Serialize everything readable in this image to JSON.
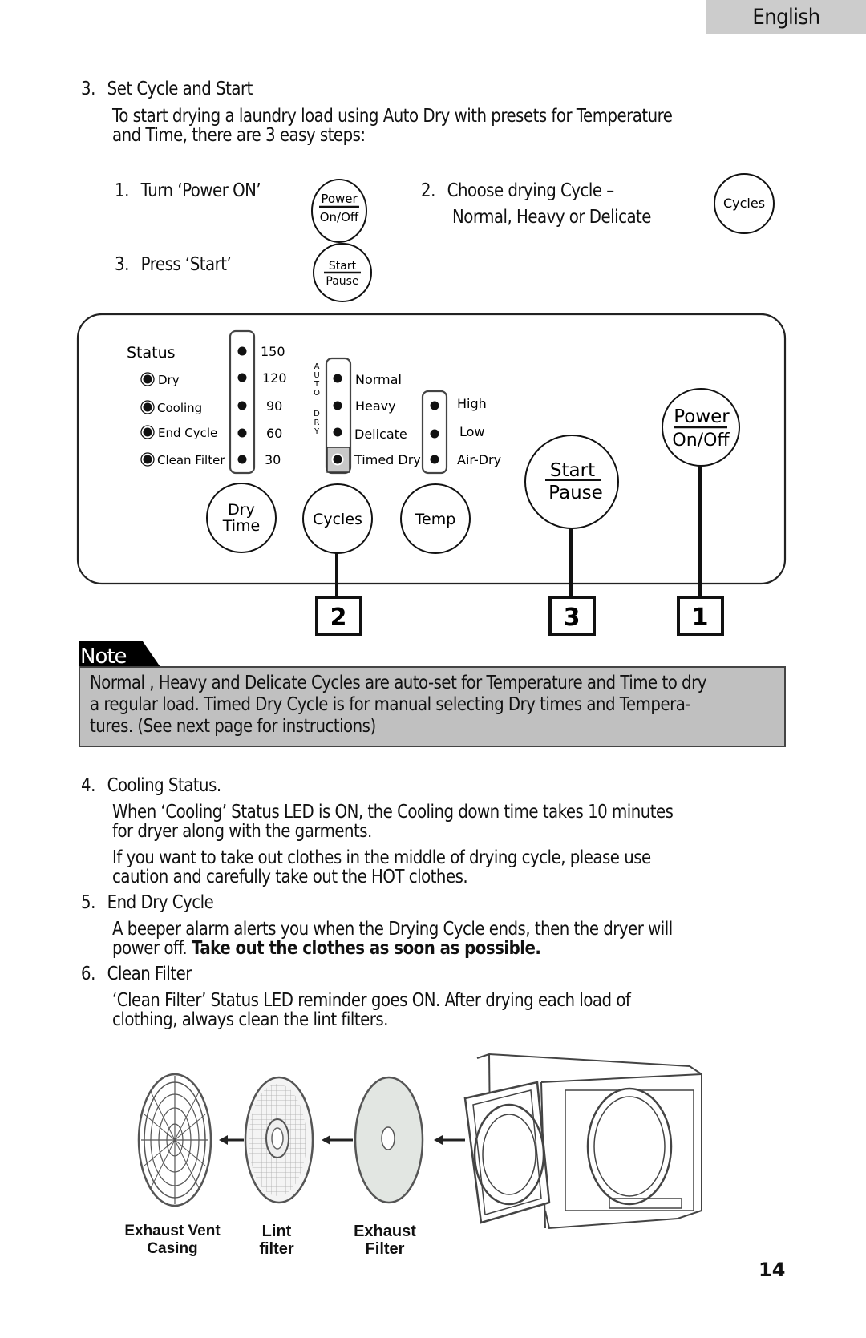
{
  "header": {
    "language_tab": "English"
  },
  "section3": {
    "heading_number": "3.",
    "heading": "Set Cycle and Start",
    "intro_lines": [
      "To start drying a laundry load using Auto Dry with presets for Temperature",
      "and Time, there are 3 easy steps:"
    ],
    "steps": [
      {
        "number": "1.",
        "text": "Turn ‘Power ON’",
        "icon_top": "Power",
        "icon_bottom": "On/Off"
      },
      {
        "number": "2.",
        "text_line1": "Choose drying Cycle –",
        "text_line2": "Normal, Heavy or Delicate",
        "icon_label": "Cycles"
      },
      {
        "number": "3.",
        "text": "Press ‘Start’",
        "icon_top": "Start",
        "icon_bottom": "Pause"
      }
    ]
  },
  "control_panel": {
    "status": {
      "title": "Status",
      "items": [
        "Dry",
        "Cooling",
        "End Cycle",
        "Clean Filter"
      ]
    },
    "dry_time": {
      "values": [
        "150",
        "120",
        "90",
        "60",
        "30"
      ],
      "button_line1": "Dry",
      "button_line2": "Time"
    },
    "cycles": {
      "vertical_label_auto": [
        "A",
        "U",
        "T",
        "O"
      ],
      "vertical_label_dry": [
        "D",
        "R",
        "Y"
      ],
      "options": [
        "Normal",
        "Heavy",
        "Delicate",
        "Timed Dry"
      ],
      "selected": "Timed Dry",
      "button_label": "Cycles"
    },
    "temp": {
      "options": [
        "High",
        "Low",
        "Air-Dry"
      ],
      "button_label": "Temp"
    },
    "start_button": {
      "top": "Start",
      "bottom": "Pause"
    },
    "power_button": {
      "top": "Power",
      "bottom": "On/Off"
    },
    "callouts": [
      {
        "label": "2",
        "target": "Cycles"
      },
      {
        "label": "3",
        "target": "Start/Pause"
      },
      {
        "label": "1",
        "target": "Power On/Off"
      }
    ]
  },
  "note": {
    "tab_label": "Note",
    "lines": [
      "Normal , Heavy and Delicate Cycles are auto-set for Temperature and Time to dry",
      "a regular load. Timed Dry Cycle is for manual selecting Dry times and Tempera-",
      "tures. (See next page for instructions)"
    ]
  },
  "items": [
    {
      "number": "4.",
      "heading": "Cooling Status.",
      "paragraphs": [
        [
          "When ‘Cooling’ Status LED is ON, the Cooling down time takes 10 minutes",
          "for dryer along with the garments."
        ],
        [
          "If you want to take out clothes in the middle of drying cycle, please use",
          "caution and carefully take out the HOT clothes."
        ]
      ]
    },
    {
      "number": "5.",
      "heading": "End Dry Cycle",
      "line1": "A beeper alarm alerts you when the Drying Cycle ends, then the dryer will",
      "line2_plain": "power off. ",
      "line2_bold": "Take out the clothes as soon as possible."
    },
    {
      "number": "6.",
      "heading": "Clean Filter",
      "lines": [
        "‘Clean Filter’ Status LED reminder goes ON. After drying each load of",
        "clothing, always clean the lint filters."
      ]
    }
  ],
  "figure": {
    "labels": {
      "exhaust_vent_casing": [
        "Exhaust Vent",
        "Casing"
      ],
      "lint_filter": [
        "Lint",
        "filter"
      ],
      "exhaust_filter": [
        "Exhaust",
        "Filter"
      ]
    }
  },
  "footer": {
    "page_number": "14"
  }
}
